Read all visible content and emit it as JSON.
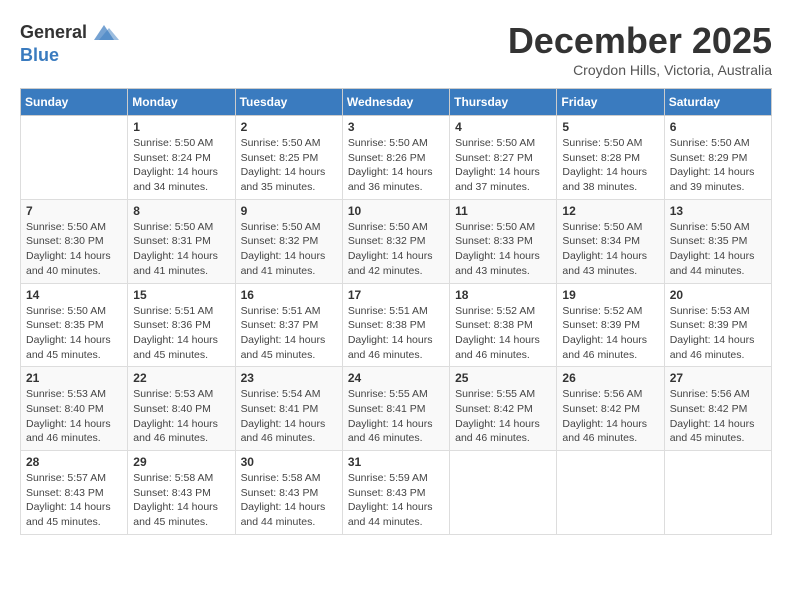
{
  "header": {
    "logo_general": "General",
    "logo_blue": "Blue",
    "month_title": "December 2025",
    "subtitle": "Croydon Hills, Victoria, Australia"
  },
  "days_of_week": [
    "Sunday",
    "Monday",
    "Tuesday",
    "Wednesday",
    "Thursday",
    "Friday",
    "Saturday"
  ],
  "weeks": [
    [
      {
        "day": "",
        "info": ""
      },
      {
        "day": "1",
        "info": "Sunrise: 5:50 AM\nSunset: 8:24 PM\nDaylight: 14 hours\nand 34 minutes."
      },
      {
        "day": "2",
        "info": "Sunrise: 5:50 AM\nSunset: 8:25 PM\nDaylight: 14 hours\nand 35 minutes."
      },
      {
        "day": "3",
        "info": "Sunrise: 5:50 AM\nSunset: 8:26 PM\nDaylight: 14 hours\nand 36 minutes."
      },
      {
        "day": "4",
        "info": "Sunrise: 5:50 AM\nSunset: 8:27 PM\nDaylight: 14 hours\nand 37 minutes."
      },
      {
        "day": "5",
        "info": "Sunrise: 5:50 AM\nSunset: 8:28 PM\nDaylight: 14 hours\nand 38 minutes."
      },
      {
        "day": "6",
        "info": "Sunrise: 5:50 AM\nSunset: 8:29 PM\nDaylight: 14 hours\nand 39 minutes."
      }
    ],
    [
      {
        "day": "7",
        "info": "Sunrise: 5:50 AM\nSunset: 8:30 PM\nDaylight: 14 hours\nand 40 minutes."
      },
      {
        "day": "8",
        "info": "Sunrise: 5:50 AM\nSunset: 8:31 PM\nDaylight: 14 hours\nand 41 minutes."
      },
      {
        "day": "9",
        "info": "Sunrise: 5:50 AM\nSunset: 8:32 PM\nDaylight: 14 hours\nand 41 minutes."
      },
      {
        "day": "10",
        "info": "Sunrise: 5:50 AM\nSunset: 8:32 PM\nDaylight: 14 hours\nand 42 minutes."
      },
      {
        "day": "11",
        "info": "Sunrise: 5:50 AM\nSunset: 8:33 PM\nDaylight: 14 hours\nand 43 minutes."
      },
      {
        "day": "12",
        "info": "Sunrise: 5:50 AM\nSunset: 8:34 PM\nDaylight: 14 hours\nand 43 minutes."
      },
      {
        "day": "13",
        "info": "Sunrise: 5:50 AM\nSunset: 8:35 PM\nDaylight: 14 hours\nand 44 minutes."
      }
    ],
    [
      {
        "day": "14",
        "info": "Sunrise: 5:50 AM\nSunset: 8:35 PM\nDaylight: 14 hours\nand 45 minutes."
      },
      {
        "day": "15",
        "info": "Sunrise: 5:51 AM\nSunset: 8:36 PM\nDaylight: 14 hours\nand 45 minutes."
      },
      {
        "day": "16",
        "info": "Sunrise: 5:51 AM\nSunset: 8:37 PM\nDaylight: 14 hours\nand 45 minutes."
      },
      {
        "day": "17",
        "info": "Sunrise: 5:51 AM\nSunset: 8:38 PM\nDaylight: 14 hours\nand 46 minutes."
      },
      {
        "day": "18",
        "info": "Sunrise: 5:52 AM\nSunset: 8:38 PM\nDaylight: 14 hours\nand 46 minutes."
      },
      {
        "day": "19",
        "info": "Sunrise: 5:52 AM\nSunset: 8:39 PM\nDaylight: 14 hours\nand 46 minutes."
      },
      {
        "day": "20",
        "info": "Sunrise: 5:53 AM\nSunset: 8:39 PM\nDaylight: 14 hours\nand 46 minutes."
      }
    ],
    [
      {
        "day": "21",
        "info": "Sunrise: 5:53 AM\nSunset: 8:40 PM\nDaylight: 14 hours\nand 46 minutes."
      },
      {
        "day": "22",
        "info": "Sunrise: 5:53 AM\nSunset: 8:40 PM\nDaylight: 14 hours\nand 46 minutes."
      },
      {
        "day": "23",
        "info": "Sunrise: 5:54 AM\nSunset: 8:41 PM\nDaylight: 14 hours\nand 46 minutes."
      },
      {
        "day": "24",
        "info": "Sunrise: 5:55 AM\nSunset: 8:41 PM\nDaylight: 14 hours\nand 46 minutes."
      },
      {
        "day": "25",
        "info": "Sunrise: 5:55 AM\nSunset: 8:42 PM\nDaylight: 14 hours\nand 46 minutes."
      },
      {
        "day": "26",
        "info": "Sunrise: 5:56 AM\nSunset: 8:42 PM\nDaylight: 14 hours\nand 46 minutes."
      },
      {
        "day": "27",
        "info": "Sunrise: 5:56 AM\nSunset: 8:42 PM\nDaylight: 14 hours\nand 45 minutes."
      }
    ],
    [
      {
        "day": "28",
        "info": "Sunrise: 5:57 AM\nSunset: 8:43 PM\nDaylight: 14 hours\nand 45 minutes."
      },
      {
        "day": "29",
        "info": "Sunrise: 5:58 AM\nSunset: 8:43 PM\nDaylight: 14 hours\nand 45 minutes."
      },
      {
        "day": "30",
        "info": "Sunrise: 5:58 AM\nSunset: 8:43 PM\nDaylight: 14 hours\nand 44 minutes."
      },
      {
        "day": "31",
        "info": "Sunrise: 5:59 AM\nSunset: 8:43 PM\nDaylight: 14 hours\nand 44 minutes."
      },
      {
        "day": "",
        "info": ""
      },
      {
        "day": "",
        "info": ""
      },
      {
        "day": "",
        "info": ""
      }
    ]
  ]
}
